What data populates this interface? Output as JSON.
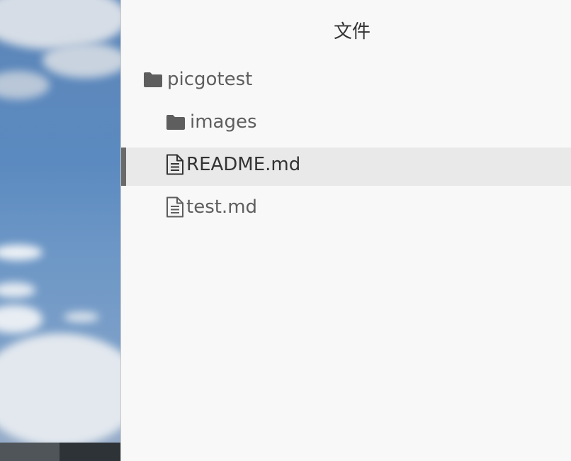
{
  "panel": {
    "title": "文件"
  },
  "tree": {
    "items": [
      {
        "label": "picgotest",
        "type": "folder",
        "depth": 0,
        "selected": false,
        "icon": "folder-icon"
      },
      {
        "label": "images",
        "type": "folder",
        "depth": 1,
        "selected": false,
        "icon": "folder-icon"
      },
      {
        "label": "README.md",
        "type": "file",
        "depth": 1,
        "selected": true,
        "icon": "document-icon"
      },
      {
        "label": "test.md",
        "type": "file",
        "depth": 1,
        "selected": false,
        "icon": "document-icon"
      }
    ]
  },
  "colors": {
    "panel_background": "#f8f8f8",
    "selected_background": "#e9e9e9",
    "selection_marker": "#6a6a6a",
    "icon": "#5e5e5e",
    "text": "#5e5e5e",
    "selected_text": "#333333"
  }
}
